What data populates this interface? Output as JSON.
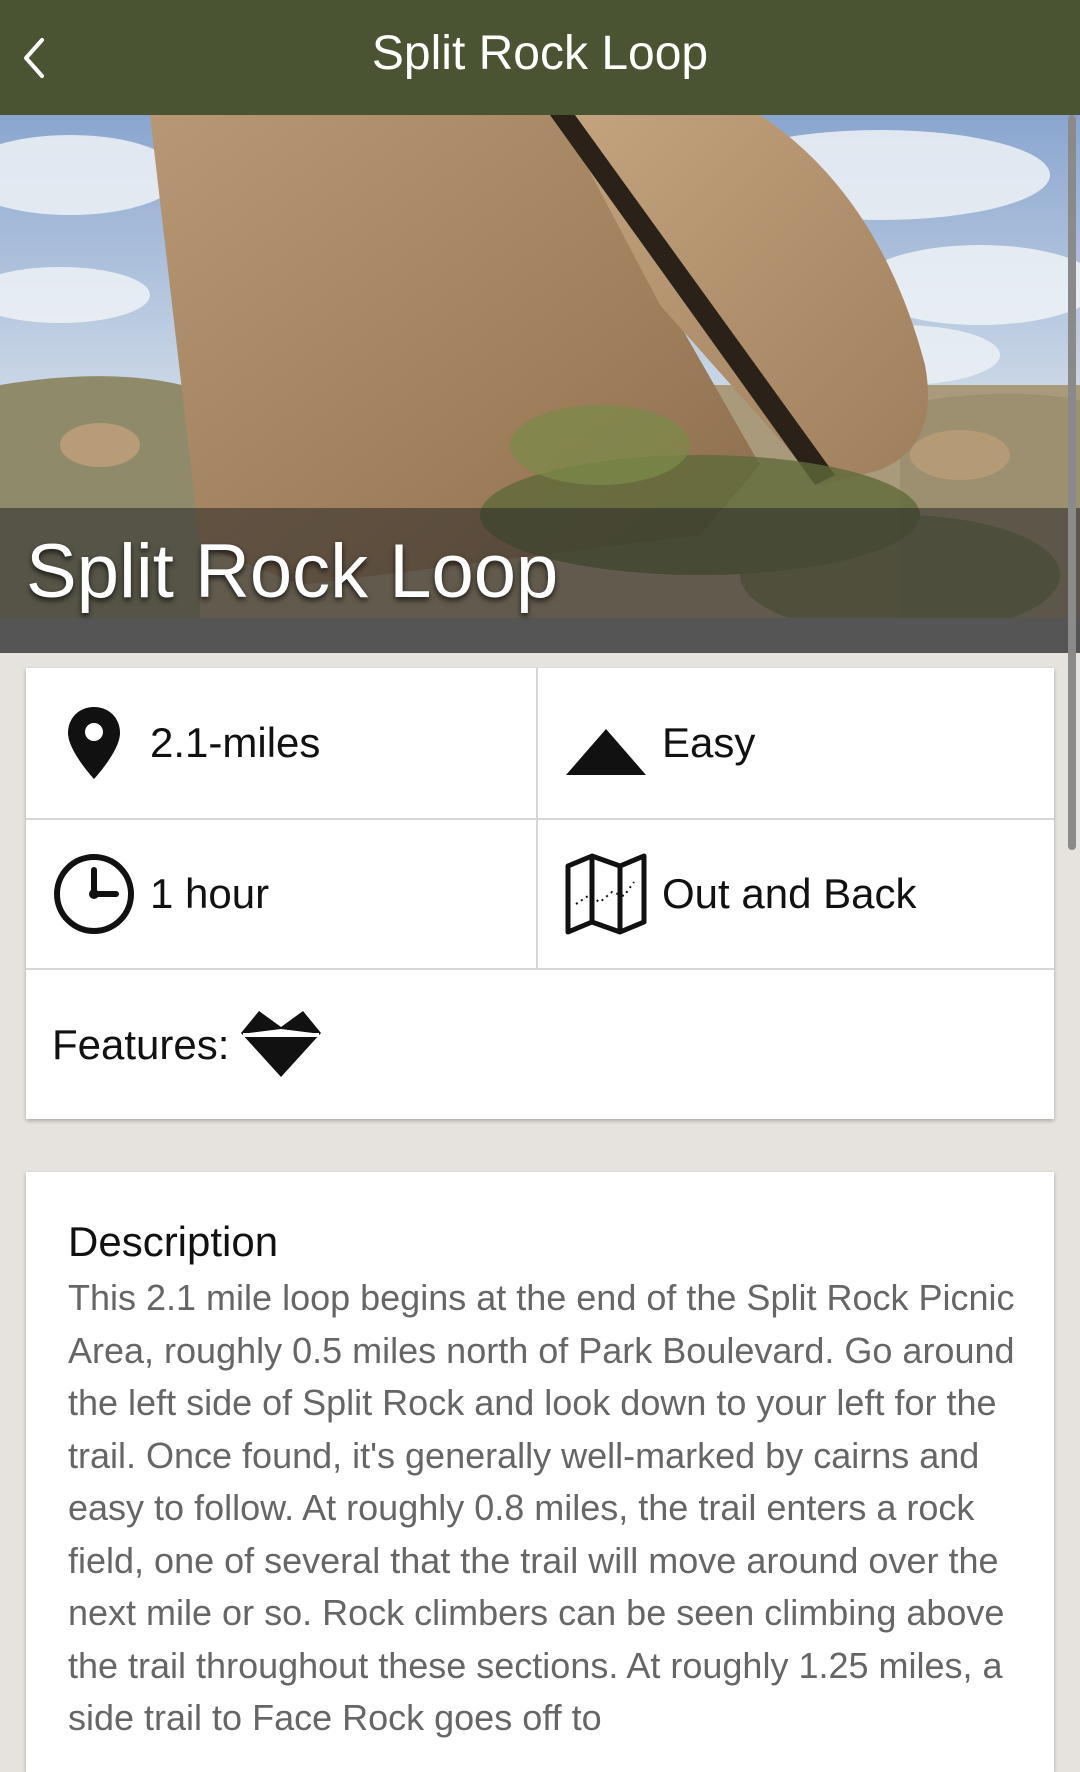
{
  "header": {
    "title": "Split Rock Loop",
    "back_icon": "chevron-left-icon"
  },
  "hero": {
    "title": "Split Rock Loop"
  },
  "stats": {
    "distance": "2.1-miles",
    "difficulty": "Easy",
    "duration": "1 hour",
    "route_type": "Out and Back",
    "features_label": "Features:"
  },
  "description": {
    "heading": "Description",
    "body": "This 2.1 mile loop begins at the end of the Split Rock Picnic Area, roughly 0.5 miles north of Park Boulevard. Go around the left side of Split Rock and look down to your left for the trail. Once found, it's generally well-marked by cairns and easy to follow. At roughly 0.8 miles, the trail enters a rock field, one of several that the trail will move around over the next mile or so. Rock climbers can be seen climbing above the trail throughout these sections. At roughly 1.25 miles, a side trail to Face Rock goes off to"
  },
  "colors": {
    "header_bg": "#4a5432",
    "page_bg": "#e6e3de"
  }
}
